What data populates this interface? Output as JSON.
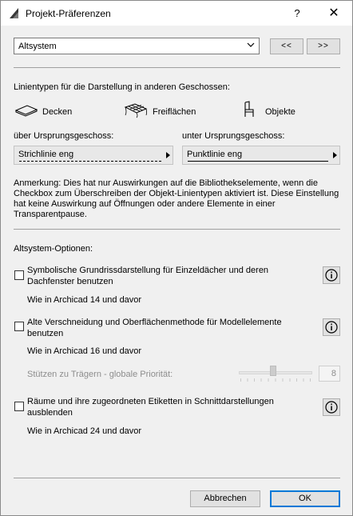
{
  "window": {
    "title": "Projekt-Präferenzen",
    "help_label": "?",
    "close_label": "✕"
  },
  "header": {
    "dropdown_value": "Altsystem",
    "prev_label": "<<",
    "next_label": ">>"
  },
  "linetypes": {
    "heading": "Linientypen für die Darstellung in anderen Geschossen:",
    "categories": [
      "Decken",
      "Freiflächen",
      "Objekte"
    ],
    "above_label": "über Ursprungsgeschoss:",
    "below_label": "unter Ursprungsgeschoss:",
    "above_value": "Strichlinie eng",
    "below_value": "Punktlinie eng",
    "note": "Anmerkung: Dies hat nur Auswirkungen auf die Bibliothekselemente, wenn die Checkbox zum Überschreiben der Objekt-Linientypen aktiviert ist. Diese Einstellung hat keine Auswirkung auf Öffnungen oder andere Elemente in einer Transparentpause."
  },
  "legacy": {
    "heading": "Altsystem-Optionen:",
    "options": [
      {
        "label": "Symbolische Grundrissdarstellung für Einzeldächer und deren Dachfenster benutzen",
        "sub": "Wie in Archicad 14 und davor",
        "checked": false
      },
      {
        "label": "Alte Verschneidung und Oberflächenmethode für Modellelemente benutzen",
        "sub": "Wie in Archicad 16 und davor",
        "checked": false
      },
      {
        "label": "Räume und ihre zugeordneten Etiketten in Schnittdarstellungen ausblenden",
        "sub": "Wie in Archicad 24 und davor",
        "checked": false
      }
    ],
    "priority_label": "Stützen zu Trägern - globale Priorität:",
    "priority_value": "8"
  },
  "footer": {
    "cancel_label": "Abbrechen",
    "ok_label": "OK"
  },
  "colors": {
    "accent": "#0078d7",
    "icon": "#000000"
  }
}
